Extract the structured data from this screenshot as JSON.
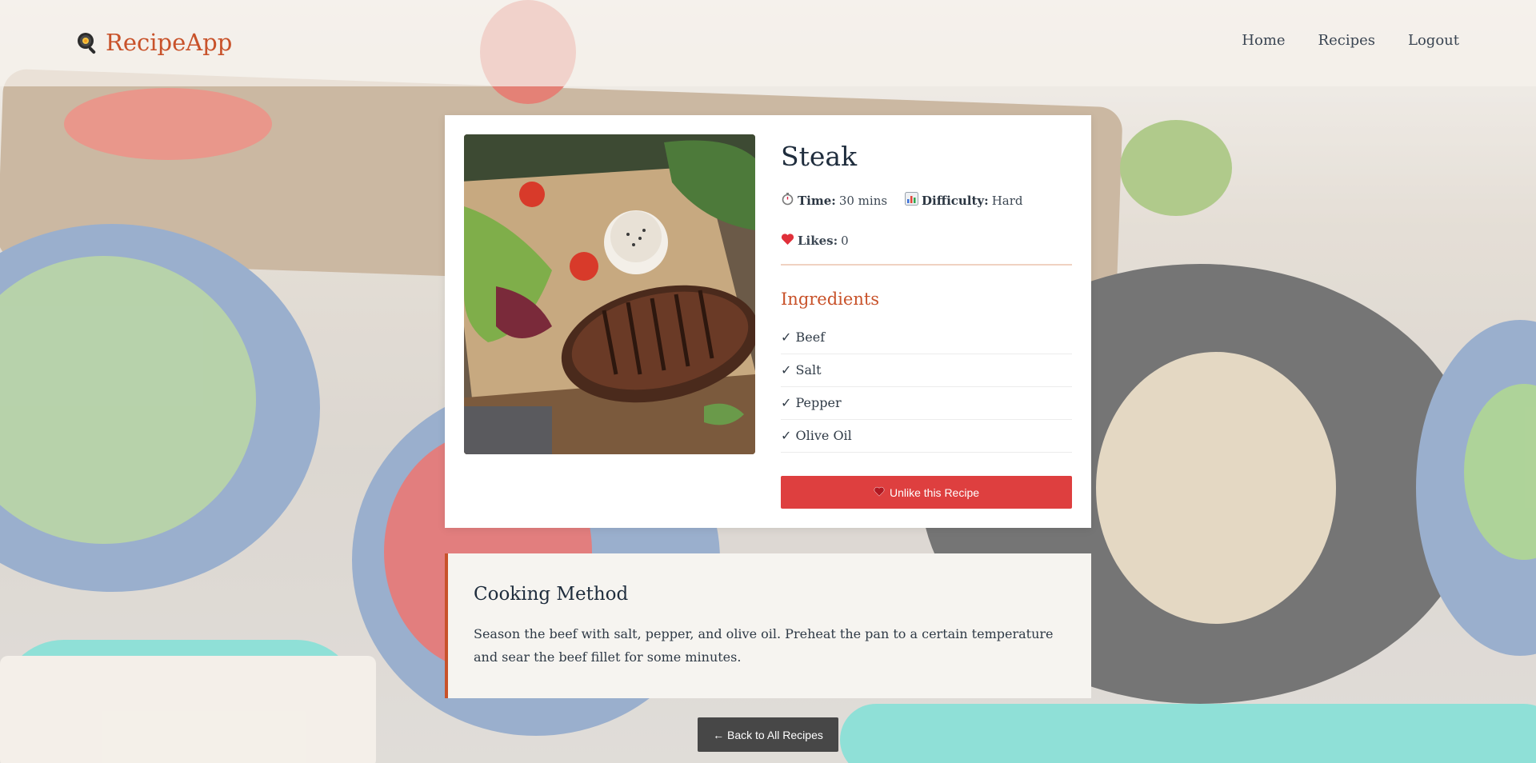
{
  "app": {
    "brand": "RecipeApp",
    "brand_icon": "frying-pan-icon",
    "accent_color": "#c8522a"
  },
  "nav": {
    "items": [
      "Home",
      "Recipes",
      "Logout"
    ]
  },
  "recipe": {
    "title": "Steak",
    "image_icon": "steak-photo",
    "time_label": "Time:",
    "time_value": "30 mins",
    "time_icon": "stopwatch-icon",
    "difficulty_label": "Difficulty:",
    "difficulty_value": "Hard",
    "difficulty_icon": "bar-chart-icon",
    "likes_label": "Likes:",
    "likes_value": "0",
    "likes_icon": "heart-icon",
    "ingredients_title": "Ingredients",
    "ingredients": [
      "✓ Beef",
      "✓ Salt",
      "✓ Pepper",
      "✓ Olive Oil"
    ],
    "unlike_button": "Unlike this Recipe",
    "unlike_color": "#de3f3f"
  },
  "method": {
    "title": "Cooking Method",
    "text": "Season the beef with salt, pepper, and olive oil. Preheat the pan to a certain temperature and sear the beef fillet for some minutes."
  },
  "back_button": "← Back to All Recipes"
}
